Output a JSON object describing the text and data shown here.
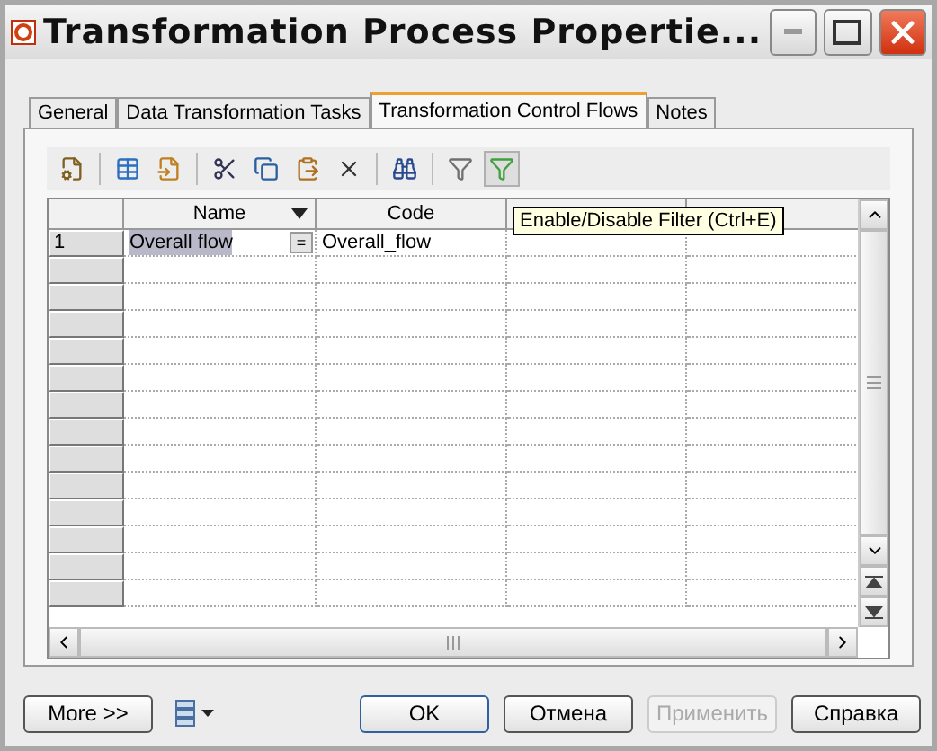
{
  "window": {
    "title": "Transformation Process Propertie..."
  },
  "tabs": [
    {
      "label": "General",
      "selected": false
    },
    {
      "label": "Data Transformation Tasks",
      "selected": false
    },
    {
      "label": "Transformation Control Flows",
      "selected": true
    },
    {
      "label": "Notes",
      "selected": false
    }
  ],
  "toolbar": [
    {
      "kind": "properties",
      "pressed": false
    },
    {
      "kind": "separator"
    },
    {
      "kind": "add-row",
      "pressed": false
    },
    {
      "kind": "insert",
      "pressed": false
    },
    {
      "kind": "separator"
    },
    {
      "kind": "cut",
      "pressed": false
    },
    {
      "kind": "copy",
      "pressed": false
    },
    {
      "kind": "paste",
      "pressed": false
    },
    {
      "kind": "delete",
      "pressed": false
    },
    {
      "kind": "separator"
    },
    {
      "kind": "find",
      "pressed": false
    },
    {
      "kind": "separator"
    },
    {
      "kind": "filter-edit",
      "pressed": false
    },
    {
      "kind": "filter",
      "pressed": true
    }
  ],
  "tooltip": "Enable/Disable Filter (Ctrl+E)",
  "table": {
    "columns": [
      {
        "label": "Name",
        "menu": true
      },
      {
        "label": "Code",
        "menu": false
      }
    ],
    "rows": [
      {
        "number": "1",
        "cells": [
          "Overall flow",
          "Overall_flow"
        ],
        "editing": true,
        "edit_button": "="
      }
    ]
  },
  "buttons": [
    {
      "label": "More >>",
      "disabled": false,
      "kind": "more"
    },
    {
      "label": "OK",
      "disabled": false,
      "kind": "default"
    },
    {
      "label": "Отмена",
      "disabled": false,
      "kind": "normal"
    },
    {
      "label": "Применить",
      "disabled": true,
      "kind": "normal"
    },
    {
      "label": "Справка",
      "disabled": false,
      "kind": "normal"
    }
  ]
}
